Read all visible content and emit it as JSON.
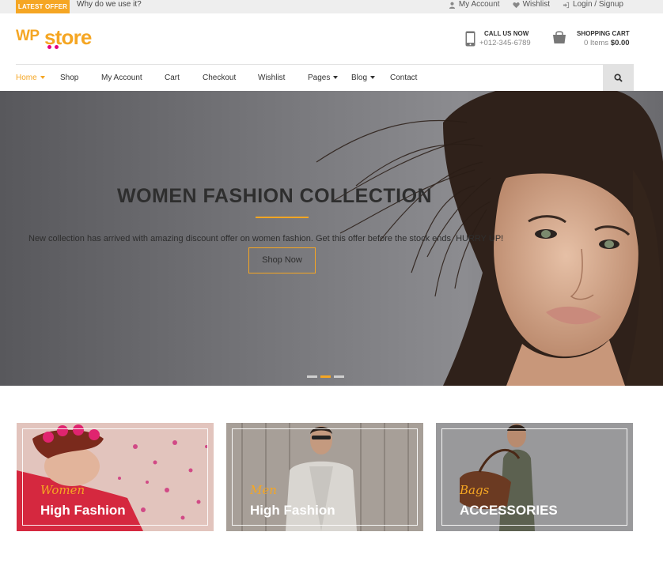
{
  "topbar": {
    "badge": "LATEST OFFER",
    "ticker": "Why do we use it?",
    "links": [
      {
        "label": "My Account",
        "icon": "user-icon"
      },
      {
        "label": "Wishlist",
        "icon": "heart-icon"
      },
      {
        "label": "Login / Signup",
        "icon": "sign-in-icon"
      }
    ]
  },
  "header": {
    "logo": {
      "prefix": "WP",
      "name": "store"
    },
    "call": {
      "label": "CALL US NOW",
      "number": "+012-345-6789",
      "icon": "mobile-phone-icon"
    },
    "cart": {
      "label": "SHOPPING CART",
      "items": "0 Items",
      "total": "$0.00",
      "icon": "shopping-bag-icon"
    }
  },
  "nav": {
    "items": [
      {
        "label": "Home",
        "active": true,
        "dropdown": true
      },
      {
        "label": "Shop"
      },
      {
        "label": "My Account"
      },
      {
        "label": "Cart"
      },
      {
        "label": "Checkout"
      },
      {
        "label": "Wishlist"
      },
      {
        "label": "Pages",
        "dropdown": true
      },
      {
        "label": "Blog",
        "dropdown": true
      },
      {
        "label": "Contact"
      }
    ],
    "search_icon": "search-icon"
  },
  "hero": {
    "title": "WOMEN FASHION COLLECTION",
    "subtitle": "New collection has arrived with amazing discount offer on women fashion. Get this offer before the stock ends. HURRY UP!",
    "button": "Shop Now",
    "slides": 3,
    "active_slide": 2
  },
  "categories": [
    {
      "script": "Women",
      "heading": "High Fashion"
    },
    {
      "script": "Men",
      "heading": "High Fashion"
    },
    {
      "script": "Bags",
      "heading": "ACCESSORIES"
    }
  ],
  "colors": {
    "accent": "#f5a623",
    "logo_dots": "#e6007e",
    "topbar": "#eeeeee",
    "search_button": "#e2e2e2"
  }
}
